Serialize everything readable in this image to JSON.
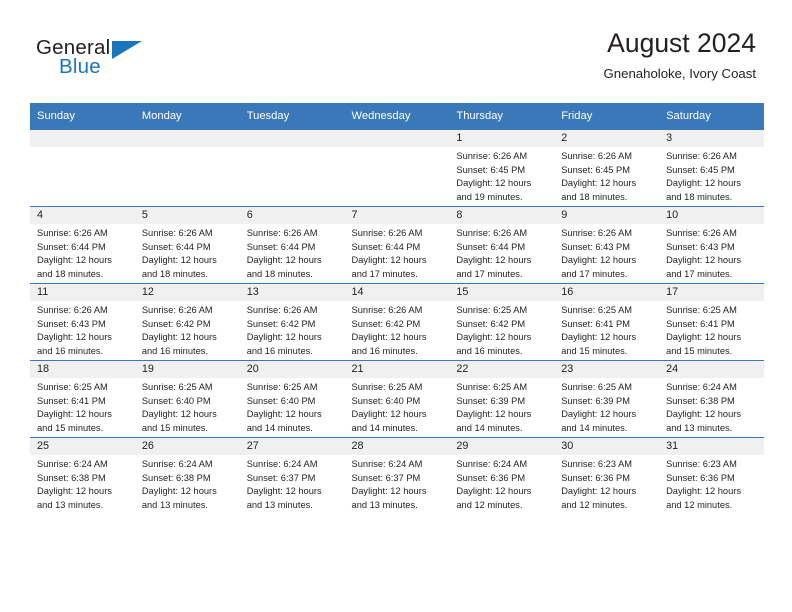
{
  "brand": {
    "name_part1": "General",
    "name_part2": "Blue",
    "accent_color": "#1b75bb"
  },
  "header": {
    "title": "August 2024",
    "subtitle": "Gnenaholoke, Ivory Coast"
  },
  "calendar": {
    "header_bg": "#3b78ba",
    "daynum_bg": "#f0f0f0",
    "weekday_headers": [
      "Sunday",
      "Monday",
      "Tuesday",
      "Wednesday",
      "Thursday",
      "Friday",
      "Saturday"
    ],
    "weeks": [
      [
        {
          "day": "",
          "empty": true
        },
        {
          "day": "",
          "empty": true
        },
        {
          "day": "",
          "empty": true
        },
        {
          "day": "",
          "empty": true
        },
        {
          "day": "1",
          "sunrise": "Sunrise: 6:26 AM",
          "sunset": "Sunset: 6:45 PM",
          "daylight_line1": "Daylight: 12 hours",
          "daylight_line2": "and 19 minutes."
        },
        {
          "day": "2",
          "sunrise": "Sunrise: 6:26 AM",
          "sunset": "Sunset: 6:45 PM",
          "daylight_line1": "Daylight: 12 hours",
          "daylight_line2": "and 18 minutes."
        },
        {
          "day": "3",
          "sunrise": "Sunrise: 6:26 AM",
          "sunset": "Sunset: 6:45 PM",
          "daylight_line1": "Daylight: 12 hours",
          "daylight_line2": "and 18 minutes."
        }
      ],
      [
        {
          "day": "4",
          "sunrise": "Sunrise: 6:26 AM",
          "sunset": "Sunset: 6:44 PM",
          "daylight_line1": "Daylight: 12 hours",
          "daylight_line2": "and 18 minutes."
        },
        {
          "day": "5",
          "sunrise": "Sunrise: 6:26 AM",
          "sunset": "Sunset: 6:44 PM",
          "daylight_line1": "Daylight: 12 hours",
          "daylight_line2": "and 18 minutes."
        },
        {
          "day": "6",
          "sunrise": "Sunrise: 6:26 AM",
          "sunset": "Sunset: 6:44 PM",
          "daylight_line1": "Daylight: 12 hours",
          "daylight_line2": "and 18 minutes."
        },
        {
          "day": "7",
          "sunrise": "Sunrise: 6:26 AM",
          "sunset": "Sunset: 6:44 PM",
          "daylight_line1": "Daylight: 12 hours",
          "daylight_line2": "and 17 minutes."
        },
        {
          "day": "8",
          "sunrise": "Sunrise: 6:26 AM",
          "sunset": "Sunset: 6:44 PM",
          "daylight_line1": "Daylight: 12 hours",
          "daylight_line2": "and 17 minutes."
        },
        {
          "day": "9",
          "sunrise": "Sunrise: 6:26 AM",
          "sunset": "Sunset: 6:43 PM",
          "daylight_line1": "Daylight: 12 hours",
          "daylight_line2": "and 17 minutes."
        },
        {
          "day": "10",
          "sunrise": "Sunrise: 6:26 AM",
          "sunset": "Sunset: 6:43 PM",
          "daylight_line1": "Daylight: 12 hours",
          "daylight_line2": "and 17 minutes."
        }
      ],
      [
        {
          "day": "11",
          "sunrise": "Sunrise: 6:26 AM",
          "sunset": "Sunset: 6:43 PM",
          "daylight_line1": "Daylight: 12 hours",
          "daylight_line2": "and 16 minutes."
        },
        {
          "day": "12",
          "sunrise": "Sunrise: 6:26 AM",
          "sunset": "Sunset: 6:42 PM",
          "daylight_line1": "Daylight: 12 hours",
          "daylight_line2": "and 16 minutes."
        },
        {
          "day": "13",
          "sunrise": "Sunrise: 6:26 AM",
          "sunset": "Sunset: 6:42 PM",
          "daylight_line1": "Daylight: 12 hours",
          "daylight_line2": "and 16 minutes."
        },
        {
          "day": "14",
          "sunrise": "Sunrise: 6:26 AM",
          "sunset": "Sunset: 6:42 PM",
          "daylight_line1": "Daylight: 12 hours",
          "daylight_line2": "and 16 minutes."
        },
        {
          "day": "15",
          "sunrise": "Sunrise: 6:25 AM",
          "sunset": "Sunset: 6:42 PM",
          "daylight_line1": "Daylight: 12 hours",
          "daylight_line2": "and 16 minutes."
        },
        {
          "day": "16",
          "sunrise": "Sunrise: 6:25 AM",
          "sunset": "Sunset: 6:41 PM",
          "daylight_line1": "Daylight: 12 hours",
          "daylight_line2": "and 15 minutes."
        },
        {
          "day": "17",
          "sunrise": "Sunrise: 6:25 AM",
          "sunset": "Sunset: 6:41 PM",
          "daylight_line1": "Daylight: 12 hours",
          "daylight_line2": "and 15 minutes."
        }
      ],
      [
        {
          "day": "18",
          "sunrise": "Sunrise: 6:25 AM",
          "sunset": "Sunset: 6:41 PM",
          "daylight_line1": "Daylight: 12 hours",
          "daylight_line2": "and 15 minutes."
        },
        {
          "day": "19",
          "sunrise": "Sunrise: 6:25 AM",
          "sunset": "Sunset: 6:40 PM",
          "daylight_line1": "Daylight: 12 hours",
          "daylight_line2": "and 15 minutes."
        },
        {
          "day": "20",
          "sunrise": "Sunrise: 6:25 AM",
          "sunset": "Sunset: 6:40 PM",
          "daylight_line1": "Daylight: 12 hours",
          "daylight_line2": "and 14 minutes."
        },
        {
          "day": "21",
          "sunrise": "Sunrise: 6:25 AM",
          "sunset": "Sunset: 6:40 PM",
          "daylight_line1": "Daylight: 12 hours",
          "daylight_line2": "and 14 minutes."
        },
        {
          "day": "22",
          "sunrise": "Sunrise: 6:25 AM",
          "sunset": "Sunset: 6:39 PM",
          "daylight_line1": "Daylight: 12 hours",
          "daylight_line2": "and 14 minutes."
        },
        {
          "day": "23",
          "sunrise": "Sunrise: 6:25 AM",
          "sunset": "Sunset: 6:39 PM",
          "daylight_line1": "Daylight: 12 hours",
          "daylight_line2": "and 14 minutes."
        },
        {
          "day": "24",
          "sunrise": "Sunrise: 6:24 AM",
          "sunset": "Sunset: 6:38 PM",
          "daylight_line1": "Daylight: 12 hours",
          "daylight_line2": "and 13 minutes."
        }
      ],
      [
        {
          "day": "25",
          "sunrise": "Sunrise: 6:24 AM",
          "sunset": "Sunset: 6:38 PM",
          "daylight_line1": "Daylight: 12 hours",
          "daylight_line2": "and 13 minutes."
        },
        {
          "day": "26",
          "sunrise": "Sunrise: 6:24 AM",
          "sunset": "Sunset: 6:38 PM",
          "daylight_line1": "Daylight: 12 hours",
          "daylight_line2": "and 13 minutes."
        },
        {
          "day": "27",
          "sunrise": "Sunrise: 6:24 AM",
          "sunset": "Sunset: 6:37 PM",
          "daylight_line1": "Daylight: 12 hours",
          "daylight_line2": "and 13 minutes."
        },
        {
          "day": "28",
          "sunrise": "Sunrise: 6:24 AM",
          "sunset": "Sunset: 6:37 PM",
          "daylight_line1": "Daylight: 12 hours",
          "daylight_line2": "and 13 minutes."
        },
        {
          "day": "29",
          "sunrise": "Sunrise: 6:24 AM",
          "sunset": "Sunset: 6:36 PM",
          "daylight_line1": "Daylight: 12 hours",
          "daylight_line2": "and 12 minutes."
        },
        {
          "day": "30",
          "sunrise": "Sunrise: 6:23 AM",
          "sunset": "Sunset: 6:36 PM",
          "daylight_line1": "Daylight: 12 hours",
          "daylight_line2": "and 12 minutes."
        },
        {
          "day": "31",
          "sunrise": "Sunrise: 6:23 AM",
          "sunset": "Sunset: 6:36 PM",
          "daylight_line1": "Daylight: 12 hours",
          "daylight_line2": "and 12 minutes."
        }
      ]
    ]
  }
}
